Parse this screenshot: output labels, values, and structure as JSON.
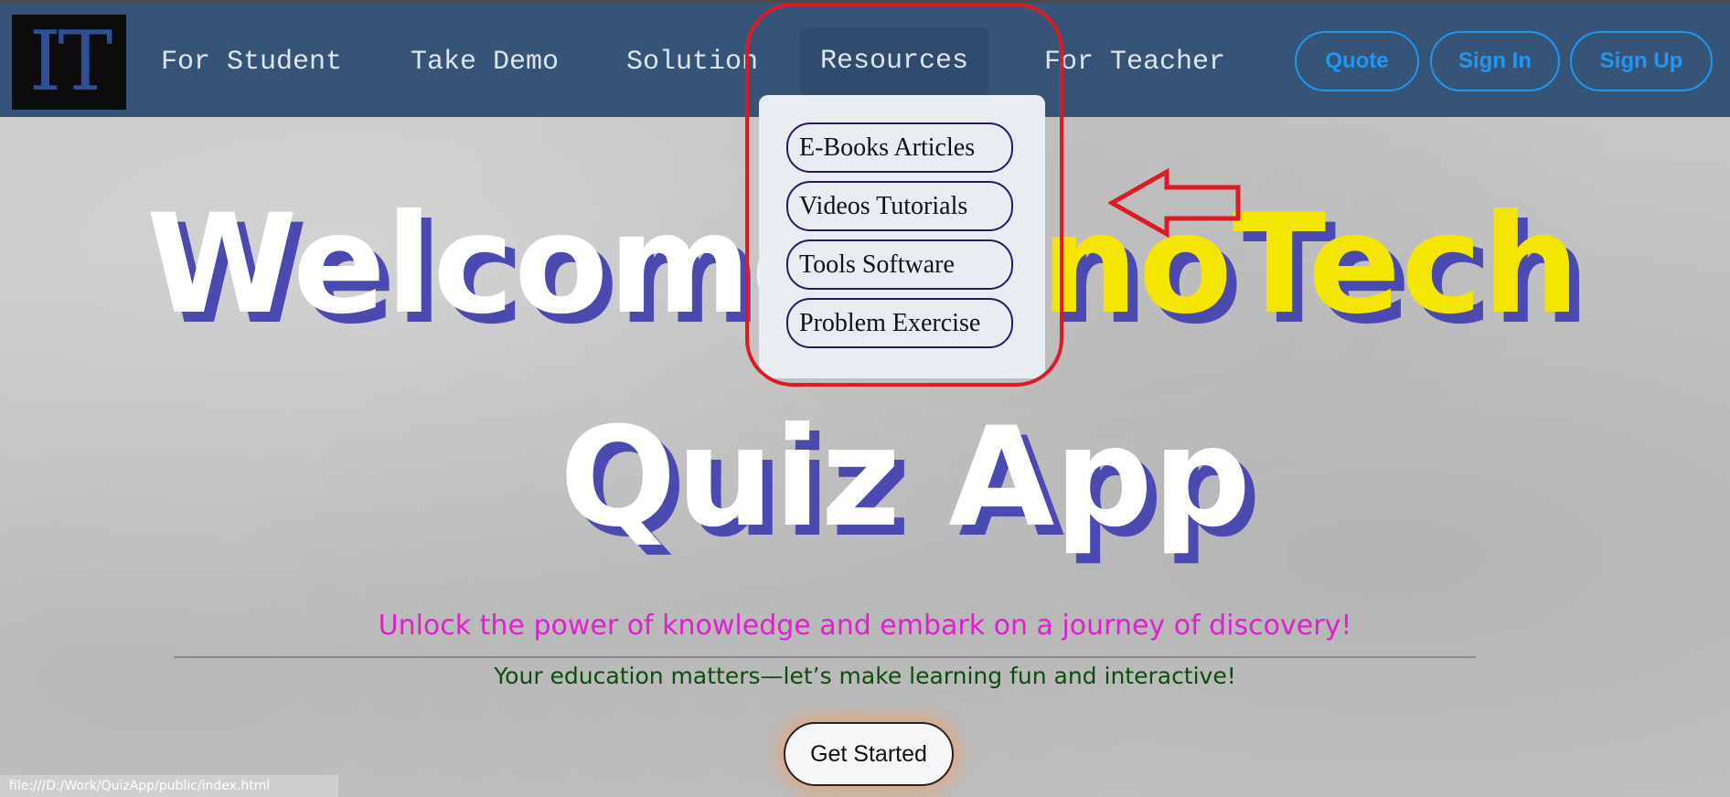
{
  "nav": {
    "logo_text": "IT",
    "links": [
      {
        "label": "For Student"
      },
      {
        "label": "Take Demo"
      },
      {
        "label": "Solution"
      },
      {
        "label": "Resources"
      },
      {
        "label": "For Teacher"
      }
    ],
    "buttons": {
      "quote": "Quote",
      "sign_in": "Sign In",
      "sign_up": "Sign Up"
    }
  },
  "dropdown": {
    "items": [
      {
        "label": "E-Books Articles"
      },
      {
        "label": "Videos Tutorials"
      },
      {
        "label": "Tools Software"
      },
      {
        "label": "Problem Exercise"
      }
    ]
  },
  "hero": {
    "line1_prefix": "Welcome ",
    "line1_brand": "InnoTech",
    "line2": "Quiz App",
    "tagline": "Unlock the power of knowledge and embark on a journey of discovery!",
    "subline": "Your education matters—let’s make learning fun and interactive!",
    "cta_label": "Get Started"
  },
  "status_bar": {
    "url": "file:///D:/Work/QuizApp/public/index.html"
  },
  "colors": {
    "navbar": "#365477",
    "nav_button": "#2196f3",
    "hero_shadow": "#4a4ab0",
    "brand": "#f5e600",
    "tagline": "#e020d0",
    "subline": "#0b4d0b",
    "annotation": "#e01a24"
  },
  "icons": {
    "annotation_arrow": "left-arrow-icon"
  }
}
